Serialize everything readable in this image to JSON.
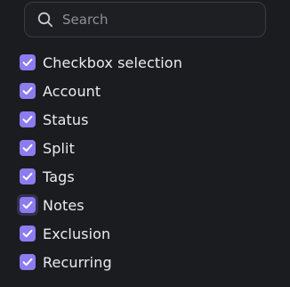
{
  "search": {
    "placeholder": "Search",
    "value": "",
    "icon": "search-icon"
  },
  "options": [
    {
      "label": "Checkbox selection",
      "checked": true
    },
    {
      "label": "Account",
      "checked": true
    },
    {
      "label": "Status",
      "checked": true
    },
    {
      "label": "Split",
      "checked": true
    },
    {
      "label": "Tags",
      "checked": true
    },
    {
      "label": "Notes",
      "checked": true,
      "focused": true
    },
    {
      "label": "Exclusion",
      "checked": true
    },
    {
      "label": "Recurring",
      "checked": true
    }
  ],
  "colors": {
    "background": "#1b1c1f",
    "accent": "#8b7cf0",
    "text": "#ececf0",
    "placeholder": "#8e9097",
    "border": "#3a3c42"
  }
}
